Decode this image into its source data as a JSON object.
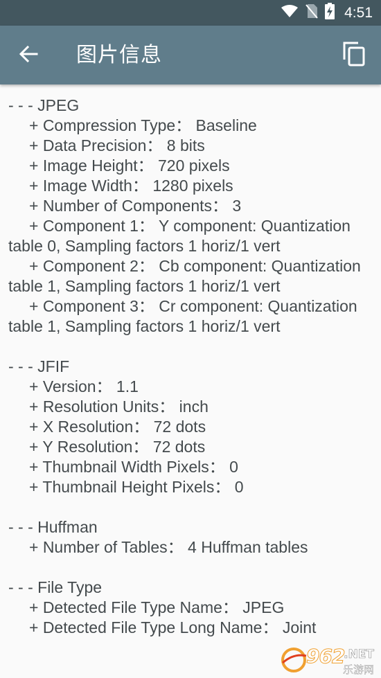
{
  "status_bar": {
    "time": "4:51",
    "icons": [
      "wifi-icon",
      "no-sim-icon",
      "battery-charging-icon"
    ]
  },
  "app_bar": {
    "title": "图片信息",
    "back_icon": "arrow-back-icon",
    "action_icon": "copy-icon"
  },
  "colors": {
    "status_bar": "#43575f",
    "app_bar": "#607d8b",
    "background": "#fafafa",
    "text": "#444a4d"
  },
  "sections": [
    {
      "header": "- - - JPEG",
      "items": [
        "+ Compression Type： Baseline",
        "+ Data Precision： 8 bits",
        "+ Image Height： 720 pixels",
        "+ Image Width： 1280 pixels",
        "+ Number of Components： 3",
        "+ Component 1： Y component: Quantization table 0, Sampling factors 1 horiz/1 vert",
        "+ Component 2： Cb component: Quantization table 1, Sampling factors 1 horiz/1 vert",
        "+ Component 3： Cr component: Quantization table 1, Sampling factors 1 horiz/1 vert"
      ]
    },
    {
      "header": "- - - JFIF",
      "items": [
        "+ Version： 1.1",
        "+ Resolution Units： inch",
        "+ X Resolution： 72 dots",
        "+ Y Resolution： 72 dots",
        "+ Thumbnail Width Pixels： 0",
        "+ Thumbnail Height Pixels： 0"
      ]
    },
    {
      "header": "- - - Huffman",
      "items": [
        "+ Number of Tables： 4 Huffman tables"
      ]
    },
    {
      "header": "- - - File Type",
      "items": [
        "+ Detected File Type Name： JPEG",
        "+ Detected File Type Long Name： Joint"
      ]
    }
  ],
  "watermark": {
    "number": "962",
    "suffix": ".NET",
    "chinese": "乐游网"
  }
}
